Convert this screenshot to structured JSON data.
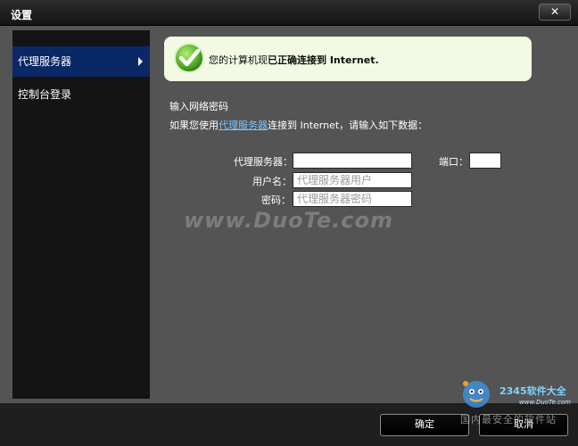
{
  "window": {
    "title": "设置",
    "close_label": "✕"
  },
  "sidebar": {
    "items": [
      {
        "label": "代理服务器",
        "active": true
      },
      {
        "label": "控制台登录",
        "active": false
      }
    ]
  },
  "status": {
    "text_prefix": "您的计算机现",
    "text_strong": "已正确连接到 Internet."
  },
  "form": {
    "section_title": "输入网络密码",
    "instruction_prefix": "如果您使用",
    "instruction_link": "代理服务器",
    "instruction_suffix": "连接到 Internet，请输入如下数据：",
    "proxy_label": "代理服务器：",
    "proxy_value": "",
    "port_label": "端口：",
    "port_value": "",
    "username_label": "用户名：",
    "username_placeholder": "代理服务器用户",
    "password_label": "密码：",
    "password_placeholder": "代理服务器密码"
  },
  "watermark": {
    "text": "www.DuoTe.com"
  },
  "footer": {
    "ok_label": "确定",
    "cancel_label": "取消"
  },
  "logo": {
    "brand": "2345软件大全",
    "site": "www.DuoTe.com",
    "slogan": "国内最安全的软件站"
  },
  "colors": {
    "status_bg": "#f3fae3",
    "sidebar_active": "#0a2766",
    "check_green": "#5cb82e",
    "link": "#7cc4ff"
  }
}
